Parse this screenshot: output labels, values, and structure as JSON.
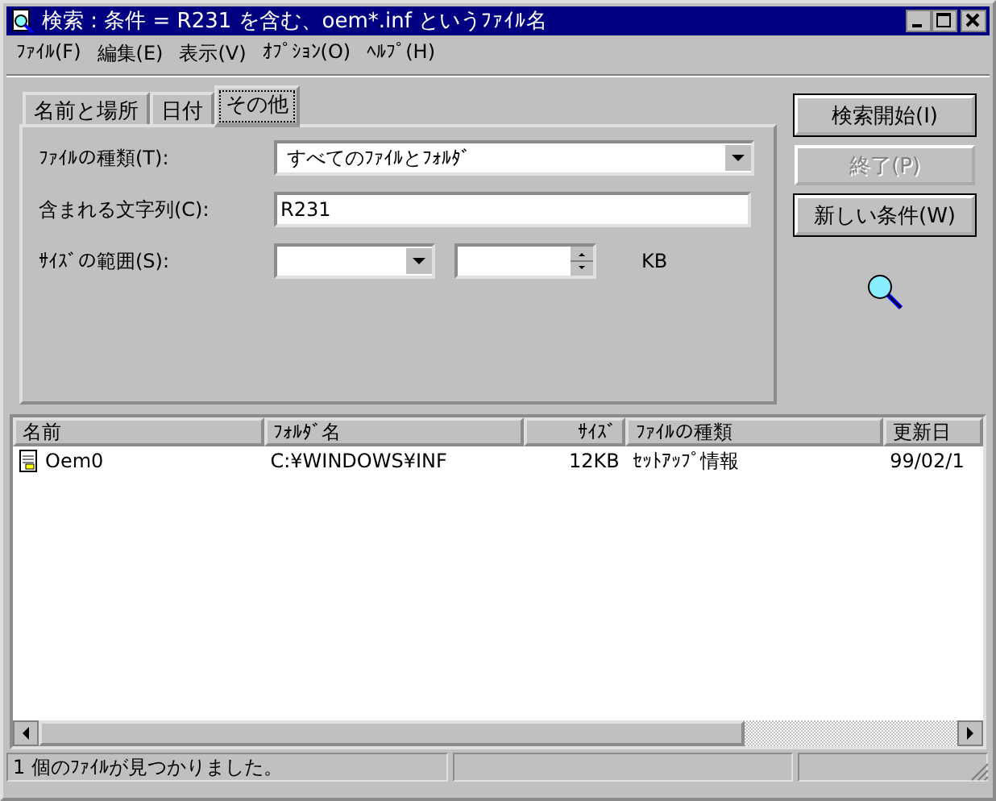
{
  "window": {
    "title": "検索 : 条件 = R231 を含む、oem*.inf というﾌｧｲﾙ名"
  },
  "menu": [
    "ﾌｧｲﾙ(F)",
    "編集(E)",
    "表示(V)",
    "ｵﾌﾟｼｮﾝ(O)",
    "ﾍﾙﾌﾟ(H)"
  ],
  "tabs": [
    {
      "label": "名前と場所",
      "selected": false
    },
    {
      "label": "日付",
      "selected": false
    },
    {
      "label": "その他",
      "selected": true
    }
  ],
  "fields": [
    {
      "kind": "dropdown",
      "label": "ﾌｧｲﾙの種類(T):",
      "value": "すべてのﾌｧｲﾙとﾌｫﾙﾀﾞ"
    },
    {
      "kind": "text",
      "label": "含まれる文字列(C):",
      "value": "R231"
    },
    {
      "kind": "size",
      "label": "ｻｲｽﾞの範囲(S):",
      "unit": "KB"
    }
  ],
  "buttons": [
    {
      "label": "検索開始(I)",
      "disabled": false
    },
    {
      "label": "終了(P)",
      "disabled": true
    },
    {
      "label": "新しい条件(W)",
      "disabled": false
    }
  ],
  "table": {
    "columns": [
      "名前",
      "ﾌｫﾙﾀﾞ名",
      "ｻｲｽﾞ",
      "ﾌｧｲﾙの種類",
      "更新日"
    ],
    "rows": [
      [
        "Oem0",
        "C:¥WINDOWS¥INF",
        "12KB",
        "ｾｯﾄｱｯﾌﾟ情報",
        "99/02/1"
      ]
    ]
  },
  "status_bar": [
    "1 個のﾌｧｲﾙが見つかりました。"
  ]
}
